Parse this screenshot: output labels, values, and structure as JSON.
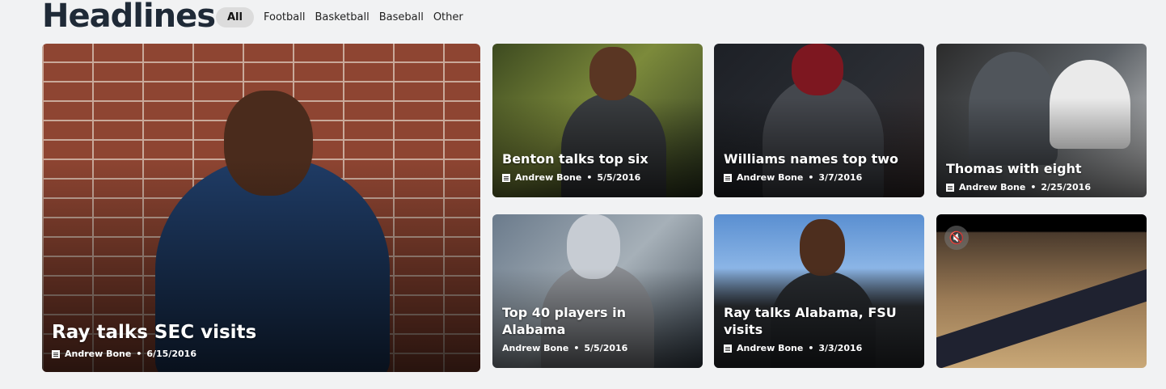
{
  "header": {
    "title": "Headlines",
    "filters": [
      "All",
      "Football",
      "Basketball",
      "Baseball",
      "Other"
    ],
    "active_filter": "All"
  },
  "cards": [
    {
      "title": "Ray talks SEC visits",
      "author": "Andrew Bone",
      "date": "6/15/2016",
      "icon": "article-icon"
    },
    {
      "title": "Benton talks top six",
      "author": "Andrew Bone",
      "date": "5/5/2016",
      "icon": "article-icon"
    },
    {
      "title": "Williams names top two",
      "author": "Andrew Bone",
      "date": "3/7/2016",
      "icon": "article-icon"
    },
    {
      "title": "Thomas with eight",
      "author": "Andrew Bone",
      "date": "2/25/2016",
      "icon": "article-icon"
    },
    {
      "title": "Top 40 players in Alabama",
      "author": "Andrew Bone",
      "date": "5/5/2016",
      "icon": "article-icon"
    },
    {
      "title": "Ray talks Alabama, FSU visits",
      "author": "Andrew Bone",
      "date": "3/3/2016",
      "icon": "article-icon"
    },
    {
      "video": true,
      "icon": "muted-speaker-icon"
    }
  ]
}
